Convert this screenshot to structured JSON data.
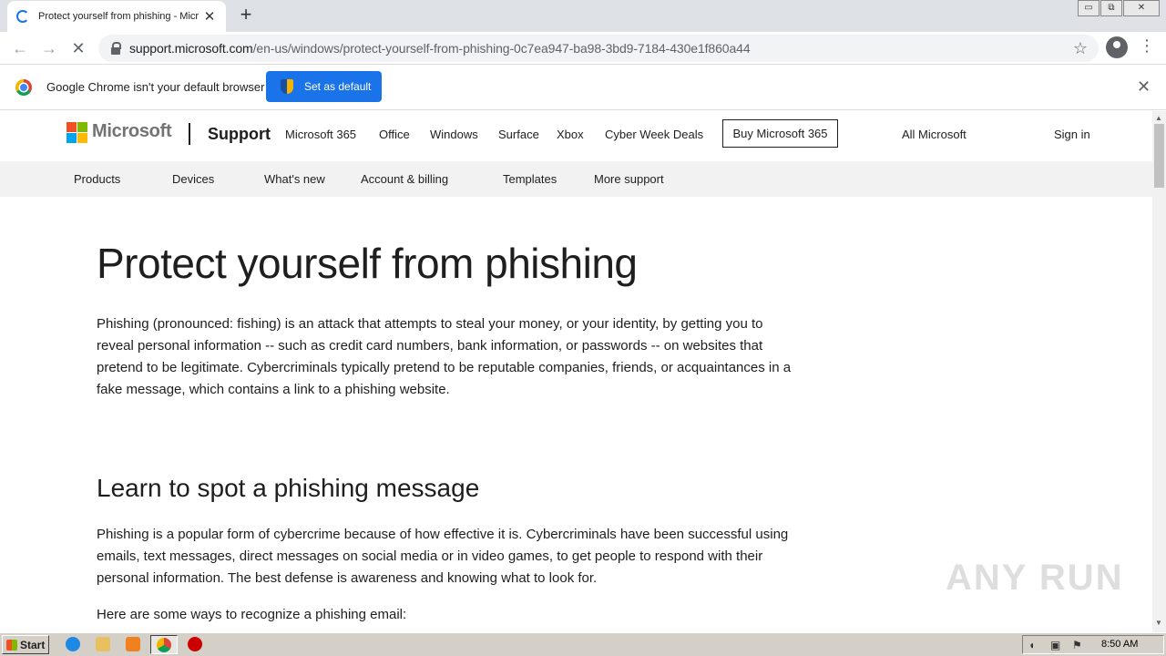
{
  "browser": {
    "tab_title": "Protect yourself from phishing - Micr",
    "tab_close": "✕",
    "new_tab": "+",
    "url_host": "support.microsoft.com",
    "url_path": "/en-us/windows/protect-yourself-from-phishing-0c7ea947-ba98-3bd9-7184-430e1f860a44",
    "back_icon": "←",
    "forward_icon": "→",
    "stop_icon": "✕",
    "star_icon": "☆",
    "menu_icon": "⋮",
    "window_controls": [
      "▭",
      "⧉",
      "✕"
    ]
  },
  "infobar": {
    "message": "Google Chrome isn't your default browser",
    "set_default_label": "Set as default",
    "close_icon": "✕"
  },
  "header": {
    "brand": "Microsoft",
    "section": "Support",
    "nav": [
      "Microsoft 365",
      "Office",
      "Windows",
      "Surface",
      "Xbox",
      "Cyber Week Deals"
    ],
    "buy_button": "Buy Microsoft 365",
    "all_microsoft": "All Microsoft",
    "sign_in": "Sign in"
  },
  "subnav": [
    "Products",
    "Devices",
    "What's new",
    "Account & billing",
    "Templates",
    "More support"
  ],
  "article": {
    "title": "Protect yourself from phishing",
    "intro": "Phishing (pronounced: fishing) is an attack that attempts to steal your money, or your identity, by getting you to reveal personal information -- such as credit card numbers, bank information, or passwords -- on websites that pretend to be legitimate. Cybercriminals typically pretend to be reputable companies, friends, or acquaintances in a fake message, which contains a link to a phishing website.",
    "section_title": "Learn to spot a phishing message",
    "section_body": "Phishing is a popular form of cybercrime because of how effective it is. Cybercriminals have been successful using emails, text messages, direct messages on social media or in video games, to get people to respond with their personal information. The best defense is awareness and knowing what to look for.",
    "ways_intro": "Here are some ways to recognize a phishing email:"
  },
  "watermark": "ANY RUN",
  "taskbar": {
    "start_label": "Start",
    "clock": "8:50 AM"
  },
  "colors": {
    "accent_blue": "#1a73e8",
    "ms_red": "#f25022",
    "ms_green": "#7fba00",
    "ms_blue": "#00a4ef",
    "ms_yellow": "#ffb900",
    "subnav_bg": "#f2f2f2"
  }
}
